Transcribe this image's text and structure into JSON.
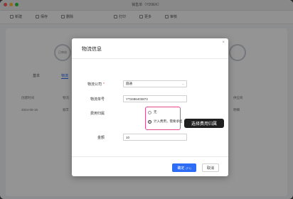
{
  "window": {
    "title": "销售单（YD9EK）",
    "colors": {
      "close": "#ff5f57",
      "min": "#febc2e",
      "max": "#28c840"
    }
  },
  "toolbar": {
    "items": [
      {
        "label": "新建",
        "icon": "new-icon"
      },
      {
        "label": "保存",
        "icon": "save-icon"
      },
      {
        "label": "删除",
        "icon": "delete-icon"
      },
      {
        "label": "打印",
        "icon": "print-icon"
      },
      {
        "label": "更多",
        "icon": "more-icon"
      },
      {
        "label": "审核",
        "icon": "audit-icon"
      }
    ]
  },
  "background": {
    "status_left": "已审核",
    "tabs": [
      "基本",
      "物流"
    ],
    "rows": [
      {
        "c1": "创建时间",
        "c2": "物流"
      },
      {
        "c1": "2024-05-15",
        "c2": "顺丰"
      }
    ],
    "right_col": [
      "供应商",
      "明细"
    ]
  },
  "modal": {
    "title": "物流信息",
    "company_label": "物流公司",
    "company_value": "圆通",
    "tracking_label": "物流单号",
    "tracking_value": "YT3486403873",
    "fee_label": "费用归属",
    "fee_options": [
      {
        "label": "无",
        "checked": false
      },
      {
        "label": "计入费用，需要承担",
        "checked": true
      }
    ],
    "amount_label": "金额",
    "amount_value": "10",
    "confirm_label": "确定",
    "confirm_shortcut": "(F1)",
    "cancel_label": "取消"
  },
  "tooltip": {
    "text": "选择费用归属"
  },
  "accent": "#2c6cf6",
  "highlight_color": "#e6478f"
}
